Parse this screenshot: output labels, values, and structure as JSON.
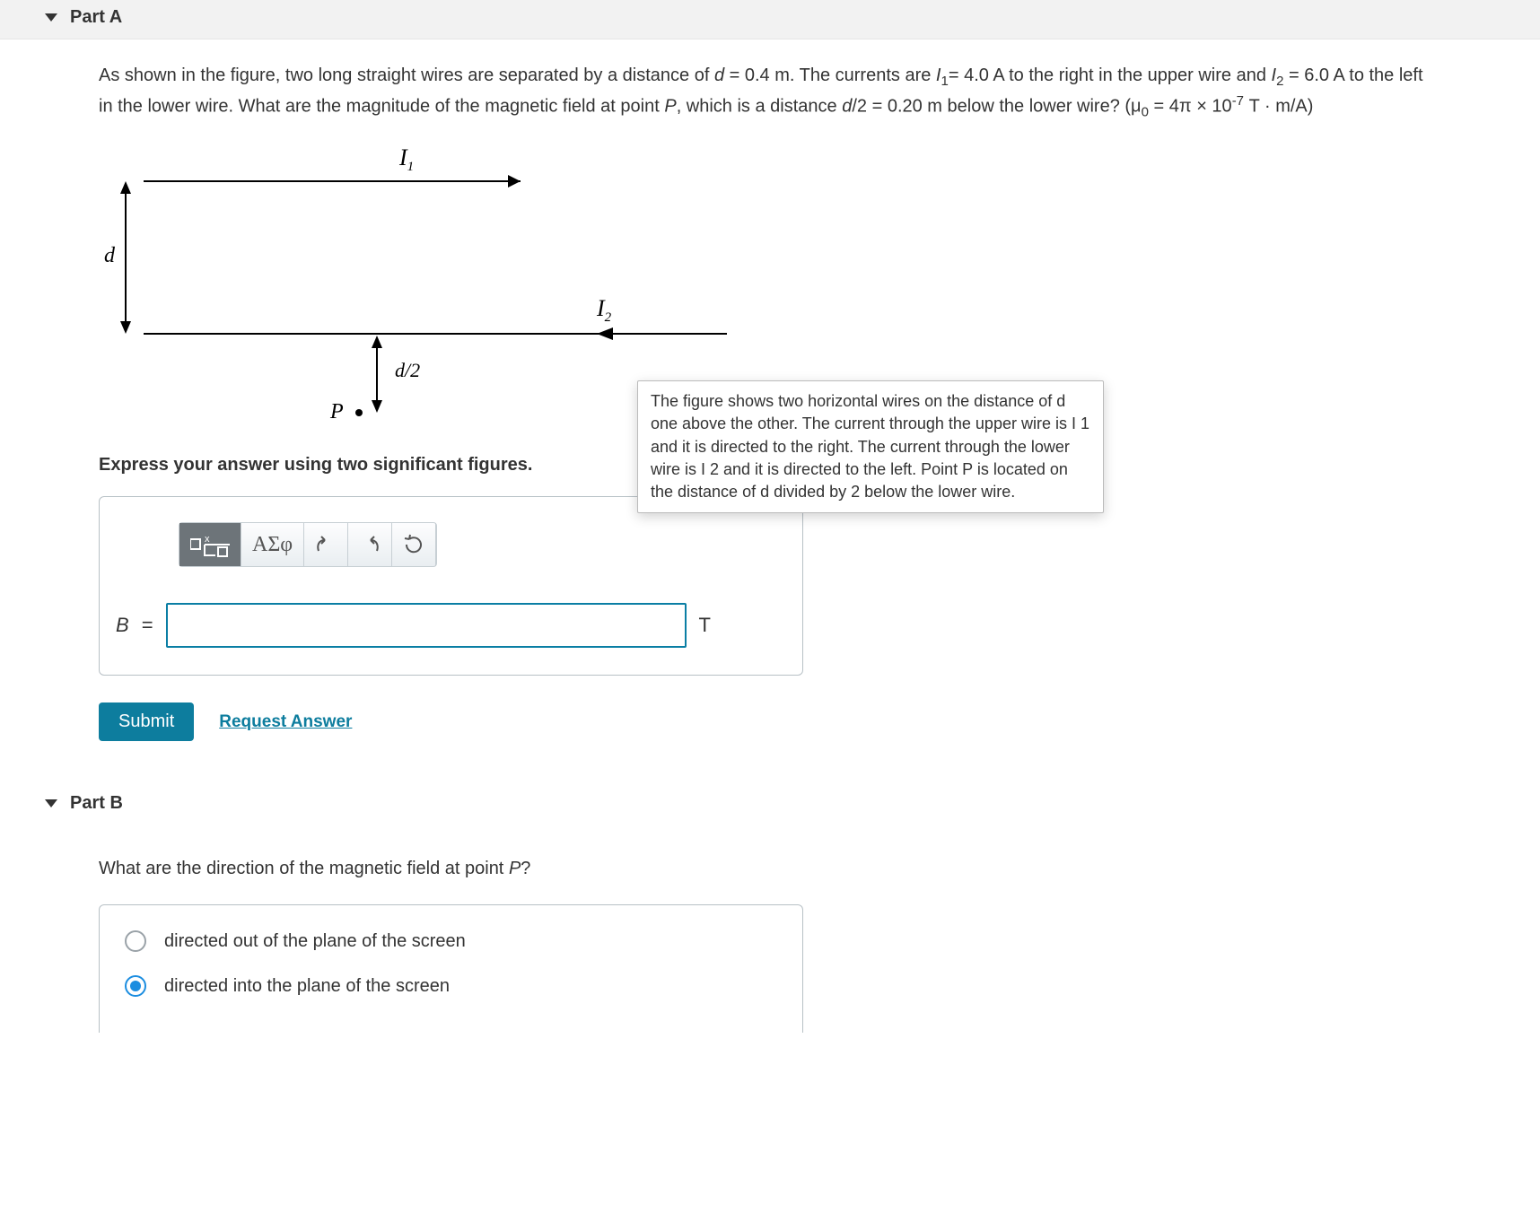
{
  "partA": {
    "header": "Part A",
    "prompt_html": "As shown in the figure, two long straight wires are separated by a distance of <span class='ital'>d</span> = 0.4 m. The currents are <span class='ital'>I</span><span class='sub-sc'>1</span>= 4.0 A to the right in the upper wire and <span class='ital'>I</span><span class='sub-sc'>2</span> = 6.0 A to the left in the lower wire. What are the magnitude of the magnetic field at point <span class='ital'>P</span>, which is a distance <span class='ital'>d</span>/2 = 0.20 m below the lower wire? (μ<span class='sub-sc'>0</span> = 4π × 10<span class='sup-sc'>-7</span> T · m/A)",
    "figure": {
      "I1": "I",
      "I1_sub": "1",
      "I2": "I",
      "I2_sub": "2",
      "d": "d",
      "dhalf": "d/2",
      "P": "P"
    },
    "tooltip": "The figure shows two horizontal wires on the distance of d one above the other. The current through the upper wire is I 1 and it is directed to the right. The current through the lower wire is I 2 and it is directed to the left. Point P is located on the distance of d divided by 2 below the lower wire.",
    "express": "Express your answer using two significant figures.",
    "toolbar_greek": "ΑΣφ",
    "lhs": "B",
    "eq": "=",
    "value": "",
    "unit": "T",
    "submit": "Submit",
    "request": "Request Answer"
  },
  "partB": {
    "header": "Part B",
    "question_html": "What are the direction of the magnetic field at point <span class='ital'>P</span>?",
    "option1": "directed out of the plane of the screen",
    "option2": "directed into the plane of the screen",
    "selected": 2
  }
}
